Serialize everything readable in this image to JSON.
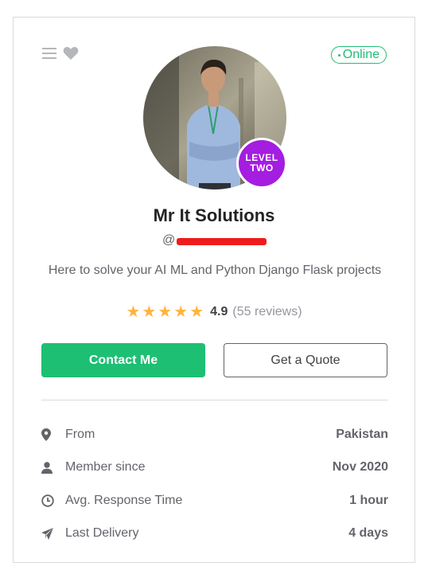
{
  "header": {
    "menu_icon": "menu-icon",
    "favorite_icon": "heart-icon",
    "status": "Online",
    "status_color": "#1dbf73"
  },
  "profile": {
    "badge_line1": "LEVEL",
    "badge_line2": "TWO",
    "badge_color": "#a41de0",
    "name": "Mr It Solutions",
    "handle_prefix": "@",
    "tagline": "Here to solve your AI ML and Python Django Flask projects",
    "rating": {
      "stars": 5,
      "score": "4.9",
      "reviews": "(55 reviews)",
      "star_color": "#ffb33e"
    }
  },
  "actions": {
    "contact_label": "Contact Me",
    "quote_label": "Get a Quote",
    "accent": "#1dbf73"
  },
  "stats": [
    {
      "icon": "location-pin-icon",
      "label": "From",
      "value": "Pakistan"
    },
    {
      "icon": "user-icon",
      "label": "Member since",
      "value": "Nov 2020"
    },
    {
      "icon": "clock-icon",
      "label": "Avg. Response Time",
      "value": "1 hour"
    },
    {
      "icon": "paper-plane-icon",
      "label": "Last Delivery",
      "value": "4 days"
    }
  ]
}
